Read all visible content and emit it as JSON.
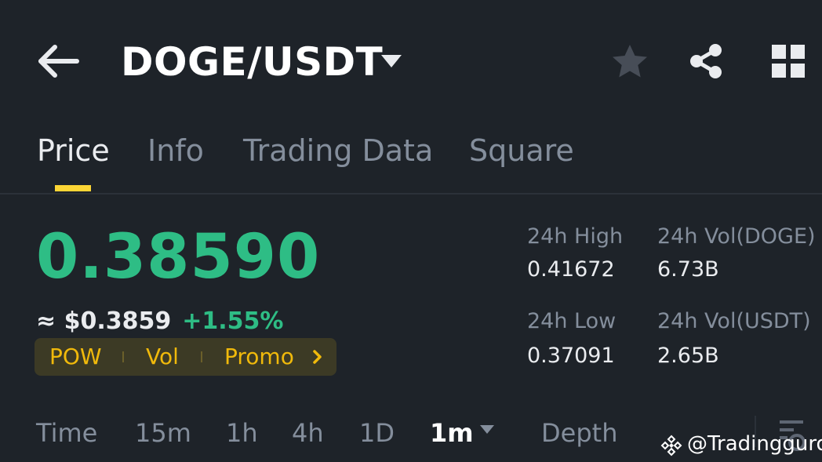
{
  "header": {
    "back_icon": "arrow-left-icon",
    "pair": "DOGE/USDT",
    "pair_dropdown_icon": "caret-down-icon",
    "favorite_icon": "star-icon",
    "share_icon": "share-icon",
    "layout_icon": "grid-icon"
  },
  "tabs": [
    {
      "label": "Price",
      "active": true
    },
    {
      "label": "Info",
      "active": false
    },
    {
      "label": "Trading Data",
      "active": false
    },
    {
      "label": "Square",
      "active": false
    }
  ],
  "ticker": {
    "last_price": "0.38590",
    "fiat_price": "≈ $0.3859",
    "change_percent": "+1.55%"
  },
  "tags": {
    "items": [
      "POW",
      "Vol",
      "Promo"
    ],
    "more_icon": "chevron-right-icon"
  },
  "stats": {
    "high_label": "24h High",
    "high_value": "0.41672",
    "low_label": "24h Low",
    "low_value": "0.37091",
    "vol_base_label": "24h Vol(DOGE)",
    "vol_base_value": "6.73B",
    "vol_quote_label": "24h Vol(USDT)",
    "vol_quote_value": "2.65B"
  },
  "intervals": {
    "items": [
      "Time",
      "15m",
      "1h",
      "4h",
      "1D",
      "1m",
      "Depth"
    ],
    "selected": "1m",
    "settings_icon": "chart-settings-icon"
  },
  "watermark": {
    "text": "@Tradingguro"
  },
  "colors": {
    "background": "#1e2329",
    "positive": "#2ebd85",
    "accent": "#fcd535",
    "tag_text": "#f0b90b",
    "muted": "#848e9c"
  }
}
